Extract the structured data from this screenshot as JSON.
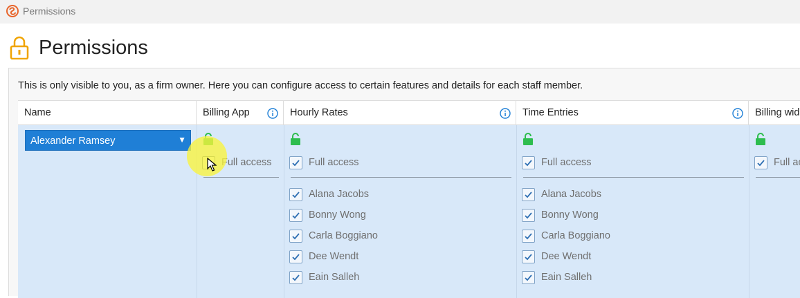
{
  "window": {
    "title": "Permissions"
  },
  "page": {
    "title": "Permissions"
  },
  "intro": "This is only visible to you, as a firm owner. Here you can configure access to certain features and details for each staff member.",
  "columns": {
    "name": "Name",
    "billing_app": "Billing App",
    "hourly_rates": "Hourly Rates",
    "time_entries": "Time Entries",
    "billing_widget": "Billing wid"
  },
  "selected_staff": "Alexander Ramsey",
  "full_access_label": "Full access",
  "billing_app_full_access_checked": false,
  "staff_members": [
    "Alana Jacobs",
    "Bonny Wong",
    "Carla Boggiano",
    "Dee Wendt",
    "Eain Salleh"
  ],
  "colors": {
    "accent_blue": "#1f7fd6",
    "row_background": "#d8e8f9",
    "unlock_green": "#2ebd4e",
    "lock_orange": "#f0a400",
    "highlight_yellow": "#f8f43c"
  }
}
